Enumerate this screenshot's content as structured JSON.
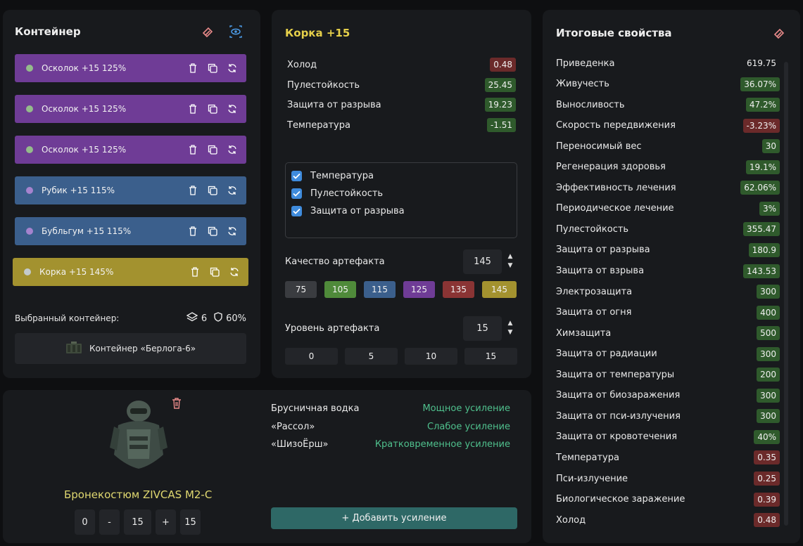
{
  "container": {
    "title": "Контейнер",
    "items": [
      {
        "label": "Осколок +15 125%",
        "color": "purple"
      },
      {
        "label": "Осколок +15 125%",
        "color": "purple"
      },
      {
        "label": "Осколок +15 125%",
        "color": "purple"
      },
      {
        "label": "Рубик +15 115%",
        "color": "blue"
      },
      {
        "label": "Бубльгум +15 115%",
        "color": "blue"
      },
      {
        "label": "Корка +15 145%",
        "color": "yellow"
      }
    ],
    "selected_label": "Выбранный контейнер:",
    "slots": "6",
    "protection": "60%",
    "container_name": "Контейнер «Берлога-6»"
  },
  "artifact": {
    "title": "Корка +15",
    "stats": [
      {
        "name": "Холод",
        "value": "0.48",
        "kind": "red"
      },
      {
        "name": "Пулестойкость",
        "value": "25.45",
        "kind": "green"
      },
      {
        "name": "Защита от разрыва",
        "value": "19.23",
        "kind": "green"
      },
      {
        "name": "Температура",
        "value": "-1.51",
        "kind": "green"
      }
    ],
    "checks": [
      "Температура",
      "Пулестойкость",
      "Защита от разрыва"
    ],
    "quality_label": "Качество артефакта",
    "quality_value": "145",
    "quality_chips": [
      "75",
      "105",
      "115",
      "125",
      "135",
      "145"
    ],
    "level_label": "Уровень артефакта",
    "level_value": "15",
    "level_chips": [
      "0",
      "5",
      "10",
      "15"
    ]
  },
  "props": {
    "title": "Итоговые свойства",
    "items": [
      {
        "name": "Приведенка",
        "value": "619.75",
        "kind": "plain"
      },
      {
        "name": "Живучесть",
        "value": "36.07%",
        "kind": "green"
      },
      {
        "name": "Выносливость",
        "value": "47.2%",
        "kind": "green"
      },
      {
        "name": "Скорость передвижения",
        "value": "-3.23%",
        "kind": "red"
      },
      {
        "name": "Переносимый вес",
        "value": "30",
        "kind": "green"
      },
      {
        "name": "Регенерация здоровья",
        "value": "19.1%",
        "kind": "green"
      },
      {
        "name": "Эффективность лечения",
        "value": "62.06%",
        "kind": "green"
      },
      {
        "name": "Периодическое лечение",
        "value": "3%",
        "kind": "green"
      },
      {
        "name": "Пулестойкость",
        "value": "355.47",
        "kind": "green"
      },
      {
        "name": "Защита от разрыва",
        "value": "180.9",
        "kind": "green"
      },
      {
        "name": "Защита от взрыва",
        "value": "143.53",
        "kind": "green"
      },
      {
        "name": "Электрозащита",
        "value": "300",
        "kind": "green"
      },
      {
        "name": "Защита от огня",
        "value": "400",
        "kind": "green"
      },
      {
        "name": "Химзащита",
        "value": "500",
        "kind": "green"
      },
      {
        "name": "Защита от радиации",
        "value": "300",
        "kind": "green"
      },
      {
        "name": "Защита от температуры",
        "value": "200",
        "kind": "green"
      },
      {
        "name": "Защита от биозаражения",
        "value": "300",
        "kind": "green"
      },
      {
        "name": "Защита от пси-излучения",
        "value": "300",
        "kind": "green"
      },
      {
        "name": "Защита от кровотечения",
        "value": "40%",
        "kind": "green"
      },
      {
        "name": "Температура",
        "value": "0.35",
        "kind": "red"
      },
      {
        "name": "Пси-излучение",
        "value": "0.25",
        "kind": "red"
      },
      {
        "name": "Биологическое заражение",
        "value": "0.39",
        "kind": "red"
      },
      {
        "name": "Холод",
        "value": "0.48",
        "kind": "red"
      }
    ]
  },
  "armor": {
    "name": "Бронекостюм ZIVCAS M2-C",
    "stepper": [
      "0",
      "-",
      "15",
      "+",
      "15"
    ],
    "boosts": [
      {
        "name": "Брусничная водка",
        "value": "Мощное усиление"
      },
      {
        "name": "«Рассол»",
        "value": "Слабое усиление"
      },
      {
        "name": "«ШизоЁрш»",
        "value": "Кратковременное усиление"
      }
    ],
    "add_label": "+ Добавить усиление"
  },
  "colors": {
    "purple": "#6f3c96",
    "blue": "#3b5f8c",
    "yellow": "#a3922f",
    "green_badge": "#2f5a2c",
    "red_badge": "#6b2a2a",
    "accent_title": "#e6d04a",
    "chips": [
      "#3a3c40",
      "#4f8a3a",
      "#3b5f8c",
      "#6f3c96",
      "#8a3434",
      "#a3922f"
    ]
  }
}
